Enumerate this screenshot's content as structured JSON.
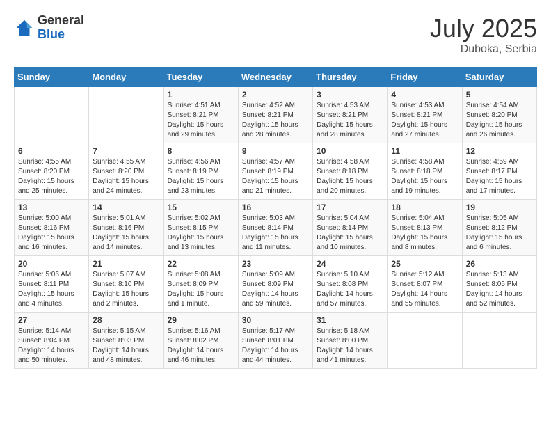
{
  "logo": {
    "general": "General",
    "blue": "Blue"
  },
  "title": {
    "month_year": "July 2025",
    "location": "Duboka, Serbia"
  },
  "days_of_week": [
    "Sunday",
    "Monday",
    "Tuesday",
    "Wednesday",
    "Thursday",
    "Friday",
    "Saturday"
  ],
  "weeks": [
    [
      {
        "day": "",
        "sunrise": "",
        "sunset": "",
        "daylight": ""
      },
      {
        "day": "",
        "sunrise": "",
        "sunset": "",
        "daylight": ""
      },
      {
        "day": "1",
        "sunrise": "Sunrise: 4:51 AM",
        "sunset": "Sunset: 8:21 PM",
        "daylight": "Daylight: 15 hours and 29 minutes."
      },
      {
        "day": "2",
        "sunrise": "Sunrise: 4:52 AM",
        "sunset": "Sunset: 8:21 PM",
        "daylight": "Daylight: 15 hours and 28 minutes."
      },
      {
        "day": "3",
        "sunrise": "Sunrise: 4:53 AM",
        "sunset": "Sunset: 8:21 PM",
        "daylight": "Daylight: 15 hours and 28 minutes."
      },
      {
        "day": "4",
        "sunrise": "Sunrise: 4:53 AM",
        "sunset": "Sunset: 8:21 PM",
        "daylight": "Daylight: 15 hours and 27 minutes."
      },
      {
        "day": "5",
        "sunrise": "Sunrise: 4:54 AM",
        "sunset": "Sunset: 8:20 PM",
        "daylight": "Daylight: 15 hours and 26 minutes."
      }
    ],
    [
      {
        "day": "6",
        "sunrise": "Sunrise: 4:55 AM",
        "sunset": "Sunset: 8:20 PM",
        "daylight": "Daylight: 15 hours and 25 minutes."
      },
      {
        "day": "7",
        "sunrise": "Sunrise: 4:55 AM",
        "sunset": "Sunset: 8:20 PM",
        "daylight": "Daylight: 15 hours and 24 minutes."
      },
      {
        "day": "8",
        "sunrise": "Sunrise: 4:56 AM",
        "sunset": "Sunset: 8:19 PM",
        "daylight": "Daylight: 15 hours and 23 minutes."
      },
      {
        "day": "9",
        "sunrise": "Sunrise: 4:57 AM",
        "sunset": "Sunset: 8:19 PM",
        "daylight": "Daylight: 15 hours and 21 minutes."
      },
      {
        "day": "10",
        "sunrise": "Sunrise: 4:58 AM",
        "sunset": "Sunset: 8:18 PM",
        "daylight": "Daylight: 15 hours and 20 minutes."
      },
      {
        "day": "11",
        "sunrise": "Sunrise: 4:58 AM",
        "sunset": "Sunset: 8:18 PM",
        "daylight": "Daylight: 15 hours and 19 minutes."
      },
      {
        "day": "12",
        "sunrise": "Sunrise: 4:59 AM",
        "sunset": "Sunset: 8:17 PM",
        "daylight": "Daylight: 15 hours and 17 minutes."
      }
    ],
    [
      {
        "day": "13",
        "sunrise": "Sunrise: 5:00 AM",
        "sunset": "Sunset: 8:16 PM",
        "daylight": "Daylight: 15 hours and 16 minutes."
      },
      {
        "day": "14",
        "sunrise": "Sunrise: 5:01 AM",
        "sunset": "Sunset: 8:16 PM",
        "daylight": "Daylight: 15 hours and 14 minutes."
      },
      {
        "day": "15",
        "sunrise": "Sunrise: 5:02 AM",
        "sunset": "Sunset: 8:15 PM",
        "daylight": "Daylight: 15 hours and 13 minutes."
      },
      {
        "day": "16",
        "sunrise": "Sunrise: 5:03 AM",
        "sunset": "Sunset: 8:14 PM",
        "daylight": "Daylight: 15 hours and 11 minutes."
      },
      {
        "day": "17",
        "sunrise": "Sunrise: 5:04 AM",
        "sunset": "Sunset: 8:14 PM",
        "daylight": "Daylight: 15 hours and 10 minutes."
      },
      {
        "day": "18",
        "sunrise": "Sunrise: 5:04 AM",
        "sunset": "Sunset: 8:13 PM",
        "daylight": "Daylight: 15 hours and 8 minutes."
      },
      {
        "day": "19",
        "sunrise": "Sunrise: 5:05 AM",
        "sunset": "Sunset: 8:12 PM",
        "daylight": "Daylight: 15 hours and 6 minutes."
      }
    ],
    [
      {
        "day": "20",
        "sunrise": "Sunrise: 5:06 AM",
        "sunset": "Sunset: 8:11 PM",
        "daylight": "Daylight: 15 hours and 4 minutes."
      },
      {
        "day": "21",
        "sunrise": "Sunrise: 5:07 AM",
        "sunset": "Sunset: 8:10 PM",
        "daylight": "Daylight: 15 hours and 2 minutes."
      },
      {
        "day": "22",
        "sunrise": "Sunrise: 5:08 AM",
        "sunset": "Sunset: 8:09 PM",
        "daylight": "Daylight: 15 hours and 1 minute."
      },
      {
        "day": "23",
        "sunrise": "Sunrise: 5:09 AM",
        "sunset": "Sunset: 8:09 PM",
        "daylight": "Daylight: 14 hours and 59 minutes."
      },
      {
        "day": "24",
        "sunrise": "Sunrise: 5:10 AM",
        "sunset": "Sunset: 8:08 PM",
        "daylight": "Daylight: 14 hours and 57 minutes."
      },
      {
        "day": "25",
        "sunrise": "Sunrise: 5:12 AM",
        "sunset": "Sunset: 8:07 PM",
        "daylight": "Daylight: 14 hours and 55 minutes."
      },
      {
        "day": "26",
        "sunrise": "Sunrise: 5:13 AM",
        "sunset": "Sunset: 8:05 PM",
        "daylight": "Daylight: 14 hours and 52 minutes."
      }
    ],
    [
      {
        "day": "27",
        "sunrise": "Sunrise: 5:14 AM",
        "sunset": "Sunset: 8:04 PM",
        "daylight": "Daylight: 14 hours and 50 minutes."
      },
      {
        "day": "28",
        "sunrise": "Sunrise: 5:15 AM",
        "sunset": "Sunset: 8:03 PM",
        "daylight": "Daylight: 14 hours and 48 minutes."
      },
      {
        "day": "29",
        "sunrise": "Sunrise: 5:16 AM",
        "sunset": "Sunset: 8:02 PM",
        "daylight": "Daylight: 14 hours and 46 minutes."
      },
      {
        "day": "30",
        "sunrise": "Sunrise: 5:17 AM",
        "sunset": "Sunset: 8:01 PM",
        "daylight": "Daylight: 14 hours and 44 minutes."
      },
      {
        "day": "31",
        "sunrise": "Sunrise: 5:18 AM",
        "sunset": "Sunset: 8:00 PM",
        "daylight": "Daylight: 14 hours and 41 minutes."
      },
      {
        "day": "",
        "sunrise": "",
        "sunset": "",
        "daylight": ""
      },
      {
        "day": "",
        "sunrise": "",
        "sunset": "",
        "daylight": ""
      }
    ]
  ]
}
